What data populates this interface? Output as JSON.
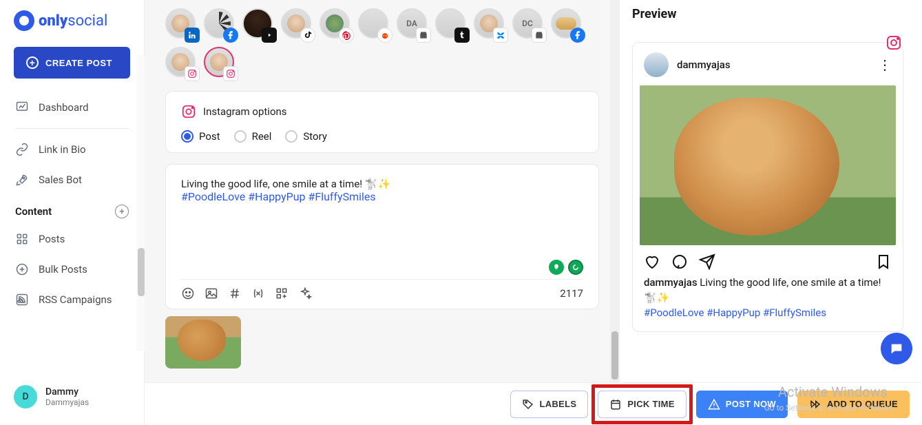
{
  "brand": {
    "name_a": "only",
    "name_b": "social"
  },
  "sidebar": {
    "create": "CREATE POST",
    "dashboard": "Dashboard",
    "linkbio": "Link in Bio",
    "salesbot": "Sales Bot",
    "content_head": "Content",
    "posts": "Posts",
    "bulk": "Bulk Posts",
    "rss": "RSS Campaigns"
  },
  "user": {
    "initial": "D",
    "name": "Dammy",
    "handle": "Dammyajas"
  },
  "accounts": [
    {
      "badge": "linkedin",
      "label": ""
    },
    {
      "badge": "facebook",
      "label": ""
    },
    {
      "badge": "youtube",
      "label": ""
    },
    {
      "badge": "tiktok",
      "label": ""
    },
    {
      "badge": "pinterest",
      "label": ""
    },
    {
      "badge": "reddit",
      "label": ""
    },
    {
      "badge": "google",
      "label": "DA"
    },
    {
      "badge": "tumblr",
      "label": ""
    },
    {
      "badge": "bluesky",
      "label": ""
    },
    {
      "badge": "google",
      "label": "DC"
    },
    {
      "badge": "facebook",
      "label": ""
    },
    {
      "badge": "instagram",
      "label": ""
    },
    {
      "badge": "instagram",
      "label": "",
      "selected": true
    }
  ],
  "ig": {
    "heading": "Instagram options",
    "opt_post": "Post",
    "opt_reel": "Reel",
    "opt_story": "Story"
  },
  "compose": {
    "text": "Living the good life, one smile at a time! 🐩✨",
    "tags": "#PoodleLove #HappyPup #FluffySmiles",
    "count": "2117"
  },
  "actions": {
    "labels": "LABELS",
    "pick": "PICK TIME",
    "post": "POST NOW",
    "queue": "ADD TO QUEUE"
  },
  "preview": {
    "title": "Preview",
    "handle": "dammyajas",
    "caption_handle": "dammyajas",
    "caption_text": " Living the good life, one smile at a time! 🐩✨",
    "caption_tags": "#PoodleLove #HappyPup #FluffySmiles"
  },
  "watermark": {
    "title": "Activate Windows",
    "sub": "Go to Settings to activate Windows."
  }
}
